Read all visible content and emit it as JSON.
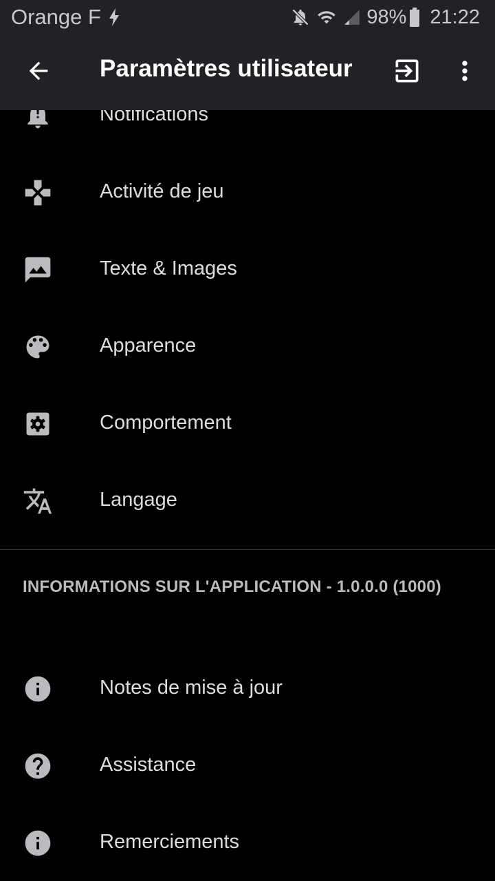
{
  "status_bar": {
    "carrier": "Orange F",
    "battery": "98%",
    "time": "21:22",
    "icons": [
      "charging-bolt-icon",
      "mute-icon",
      "wifi-icon",
      "signal-icon",
      "battery-icon"
    ]
  },
  "app_bar": {
    "title": "Paramètres utilisateur",
    "background": "#202225"
  },
  "settings": {
    "items": [
      {
        "label": "Notifications",
        "icon": "bell-icon"
      },
      {
        "label": "Activité de jeu",
        "icon": "gamepad-icon"
      },
      {
        "label": "Texte & Images",
        "icon": "image-icon"
      },
      {
        "label": "Apparence",
        "icon": "palette-icon"
      },
      {
        "label": "Comportement",
        "icon": "gear-icon"
      },
      {
        "label": "Langage",
        "icon": "translate-icon"
      }
    ]
  },
  "app_info": {
    "header": "INFORMATIONS SUR L'APPLICATION - 1.0.0.0 (1000)",
    "items": [
      {
        "label": "Notes de mise à jour",
        "icon": "info-icon"
      },
      {
        "label": "Assistance",
        "icon": "help-icon"
      },
      {
        "label": "Remerciements",
        "icon": "info-icon"
      }
    ]
  },
  "colors": {
    "background": "#000000",
    "toolbar": "#202225",
    "text": "#dcddde",
    "icon": "#b9bbbe",
    "section_header": "#b9bbbe"
  }
}
